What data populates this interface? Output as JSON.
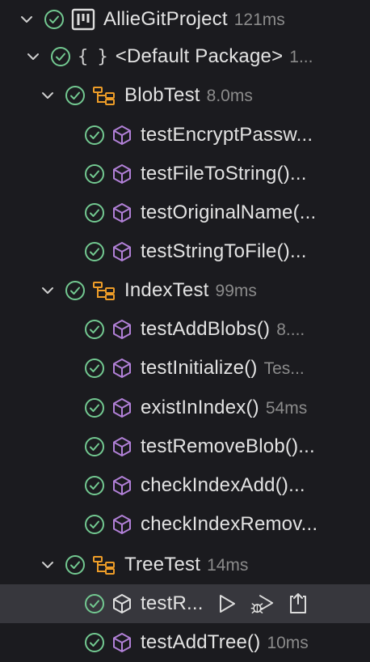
{
  "colors": {
    "pass": "#73c991",
    "method_icon": "#b180d7",
    "class_icon": "#ee9d28",
    "background": "#1b1b1f",
    "selected_row": "#37373d"
  },
  "tree": {
    "project": {
      "name": "AllieGitProject",
      "duration": "121ms",
      "icon": "project-board-icon"
    },
    "package": {
      "braces": "{ }",
      "name": "<Default Package>",
      "duration": "1..."
    },
    "blob_test": {
      "name": "BlobTest",
      "duration": "8.0ms",
      "methods": [
        {
          "name": "testEncryptPassw..."
        },
        {
          "name": "testFileToString()..."
        },
        {
          "name": "testOriginalName(..."
        },
        {
          "name": "testStringToFile()..."
        }
      ]
    },
    "index_test": {
      "name": "IndexTest",
      "duration": "99ms",
      "methods": [
        {
          "name": "testAddBlobs()",
          "duration": "8...."
        },
        {
          "name": "testInitialize()",
          "duration": "Tes..."
        },
        {
          "name": "existInIndex()",
          "duration": "54ms"
        },
        {
          "name": "testRemoveBlob()..."
        },
        {
          "name": "checkIndexAdd()..."
        },
        {
          "name": "checkIndexRemov..."
        }
      ]
    },
    "tree_test": {
      "name": "TreeTest",
      "duration": "14ms",
      "methods": [
        {
          "name": "testR..."
        },
        {
          "name": "testAddTree()",
          "duration": "10ms"
        }
      ]
    }
  },
  "actions": {
    "run": "run-test-icon",
    "debug": "debug-test-icon",
    "goto": "go-to-test-icon"
  }
}
